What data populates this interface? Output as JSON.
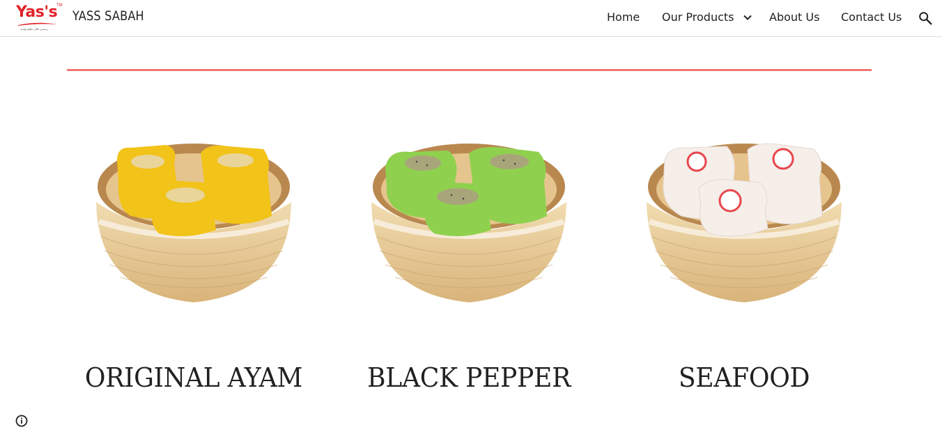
{
  "header": {
    "logo": {
      "brand_text": "Yas's",
      "tm": "TM",
      "tagline": "رسمي حلال بطعم ولذيذ"
    },
    "site_title": "YASS SABAH",
    "nav": [
      {
        "label": "Home"
      },
      {
        "label": "Our Products"
      },
      {
        "label": "About Us"
      },
      {
        "label": "Contact Us"
      }
    ],
    "icons": {
      "dropdown": "chevron-down-icon",
      "search": "search-icon"
    }
  },
  "colors": {
    "accent_line": "#ef7673",
    "brand_red": "#e0232a",
    "wrapper_yellow": "#f2c318",
    "wrapper_green": "#8fd14f",
    "wrapper_white": "#f5eee9",
    "steamer_wood": "#e8cc98"
  },
  "products": [
    {
      "name": "ORIGINAL AYAM",
      "image": "yellow-siomay-steamer-image"
    },
    {
      "name": "BLACK PEPPER",
      "image": "green-siomay-steamer-image"
    },
    {
      "name": "SEAFOOD",
      "image": "white-siomay-steamer-image"
    }
  ],
  "footer": {
    "info_icon": "info-icon"
  }
}
